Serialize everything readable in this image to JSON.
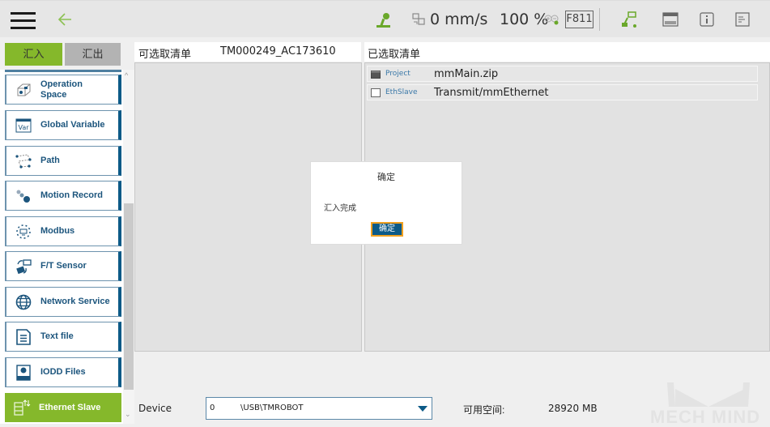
{
  "topbar": {
    "menu_icon": "hamburger-icon",
    "back_icon": "back-arrow-icon",
    "robot_status_icon": "robot-arm-icon",
    "speed_icon": "speed-mode-icon",
    "speed": "0 mm/s",
    "percent": "100 %",
    "zoom_icon": "zoom-plus-minus-icon",
    "station_code": "F811",
    "connection_icon": "robot-connection-icon",
    "display_icon": "display-panel-icon",
    "info_icon": "info-icon",
    "log_icon": "log-icon"
  },
  "tabs": {
    "import_label": "汇入",
    "export_label": "汇出"
  },
  "categories": [
    {
      "label": "Operation Space",
      "icon": "operation-space-icon",
      "active": false
    },
    {
      "label": "Global Variable",
      "icon": "global-variable-icon",
      "active": false
    },
    {
      "label": "Path",
      "icon": "path-icon",
      "active": false
    },
    {
      "label": "Motion Record",
      "icon": "motion-record-icon",
      "active": false
    },
    {
      "label": "Modbus",
      "icon": "modbus-icon",
      "active": false
    },
    {
      "label": "F/T Sensor",
      "icon": "ft-sensor-icon",
      "active": false
    },
    {
      "label": "Network Service",
      "icon": "network-service-icon",
      "active": false
    },
    {
      "label": "Text file",
      "icon": "text-file-icon",
      "active": false
    },
    {
      "label": "IODD Files",
      "icon": "iodd-files-icon",
      "active": false
    },
    {
      "label": "Ethernet Slave",
      "icon": "ethernet-slave-icon",
      "active": true
    }
  ],
  "available": {
    "label": "可选取清单",
    "device_id": "TM000249_AC173610"
  },
  "selected": {
    "label": "已选取清单",
    "items": [
      {
        "type": "Project",
        "name": "mmMain.zip"
      },
      {
        "type": "EthSlave",
        "name": "Transmit/mmEthernet"
      }
    ]
  },
  "dialog": {
    "title": "确定",
    "message": "汇入完成",
    "ok_label": "确定"
  },
  "bottom": {
    "device_label": "Device",
    "device_index": "0",
    "device_path": "\\USB\\TMROBOT",
    "space_label": "可用空间:",
    "space_value": "28920 MB"
  },
  "watermark": "MECH MIND",
  "colors": {
    "accent_green": "#85b82b",
    "accent_blue": "#0c5a87",
    "focus_orange": "#f0a020"
  }
}
